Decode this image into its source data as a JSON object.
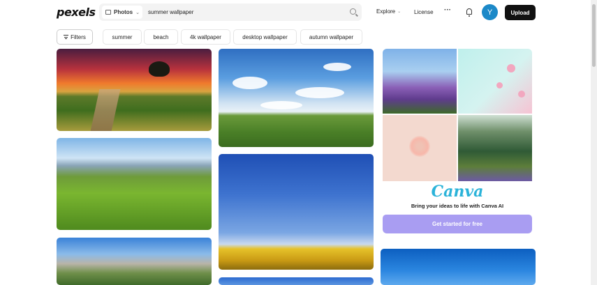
{
  "header": {
    "logo": "pexels",
    "search": {
      "type_label": "Photos",
      "query": "summer wallpaper"
    },
    "nav": {
      "explore": "Explore",
      "license": "License",
      "more": "···"
    },
    "avatar_initial": "Y",
    "upload_label": "Upload"
  },
  "filters": {
    "button_label": "Filters",
    "chips": [
      "summer",
      "beach",
      "4k wallpaper",
      "desktop wallpaper",
      "autumn wallpaper"
    ]
  },
  "ad": {
    "brand": "Canva",
    "tagline": "Bring your ideas to life with Canva AI",
    "cta": "Get started for free"
  },
  "icons": {
    "search": "search-icon",
    "bell": "bell-icon",
    "filters": "filters-icon",
    "photo_type": "image-icon",
    "chevron": "chevron-down-icon"
  }
}
